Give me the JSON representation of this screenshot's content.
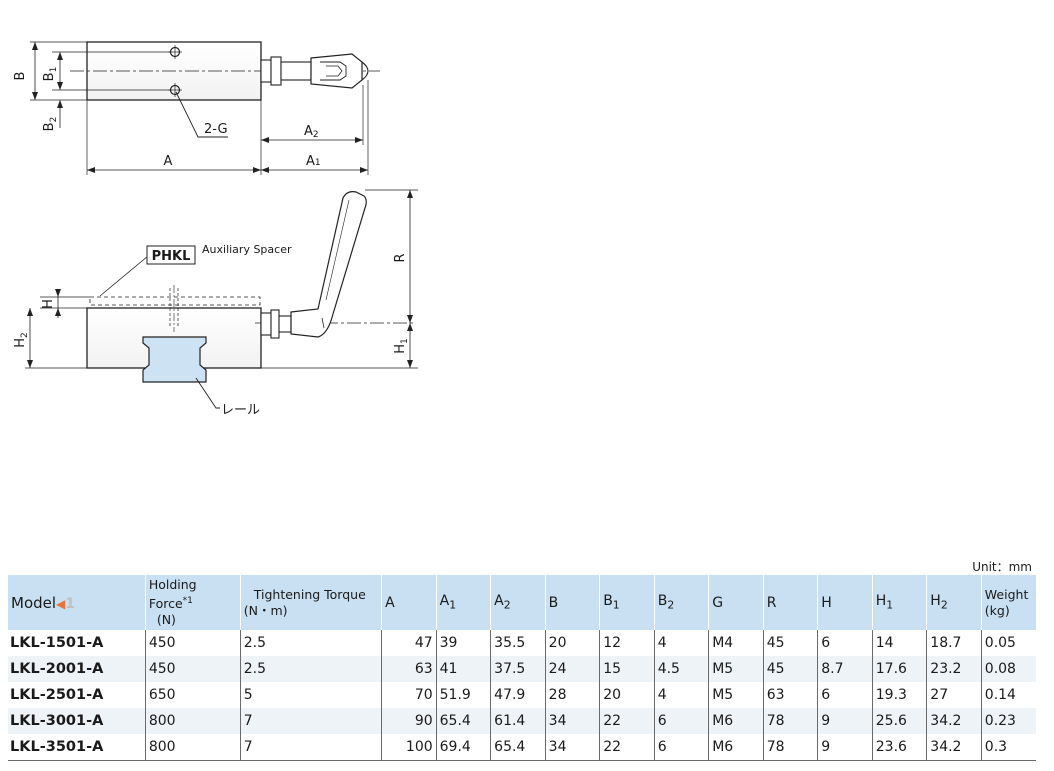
{
  "drawing": {
    "top_view": {
      "label_B": "B",
      "label_B1": "B",
      "label_B1_sub": "1",
      "label_B2": "B",
      "label_B2_sub": "2",
      "label_2G": "2-G",
      "label_A": "A",
      "label_A1": "A",
      "label_A1_sub": "1",
      "label_A2": "A",
      "label_A2_sub": "2"
    },
    "side_view": {
      "phkl": "PHKL",
      "aux_spacer": "Auxiliary Spacer",
      "label_H": "H",
      "label_H2": "H",
      "label_H2_sub": "2",
      "label_R": "R",
      "label_H1": "H",
      "label_H1_sub": "1",
      "rail": "レール"
    }
  },
  "table": {
    "unit": "Unit：mm",
    "headers": {
      "model": "Model",
      "model_flag_num": "1",
      "holding_force": "Holding Force",
      "holding_force_note": "*1",
      "holding_force_unit": "(N)",
      "torque": "Tightening Torque",
      "torque_unit": "(N・m)",
      "A": "A",
      "A1": "A",
      "A1_sub": "1",
      "A2": "A",
      "A2_sub": "2",
      "B": "B",
      "B1": "B",
      "B1_sub": "1",
      "B2": "B",
      "B2_sub": "2",
      "G": "G",
      "R": "R",
      "H": "H",
      "H1": "H",
      "H1_sub": "1",
      "H2": "H",
      "H2_sub": "2",
      "weight": "Weight",
      "weight_unit": "(kg)"
    },
    "rows": [
      {
        "model": "LKL-1501-A",
        "force": "450",
        "torque": "2.5",
        "A": "47",
        "A1": "39",
        "A2": "35.5",
        "B": "20",
        "B1": "12",
        "B2": "4",
        "G": "M4",
        "R": "45",
        "H": "6",
        "H1": "14",
        "H2": "18.7",
        "weight": "0.05"
      },
      {
        "model": "LKL-2001-A",
        "force": "450",
        "torque": "2.5",
        "A": "63",
        "A1": "41",
        "A2": "37.5",
        "B": "24",
        "B1": "15",
        "B2": "4.5",
        "G": "M5",
        "R": "45",
        "H": "8.7",
        "H1": "17.6",
        "H2": "23.2",
        "weight": "0.08"
      },
      {
        "model": "LKL-2501-A",
        "force": "650",
        "torque": "5",
        "A": "70",
        "A1": "51.9",
        "A2": "47.9",
        "B": "28",
        "B1": "20",
        "B2": "4",
        "G": "M5",
        "R": "63",
        "H": "6",
        "H1": "19.3",
        "H2": "27",
        "weight": "0.14"
      },
      {
        "model": "LKL-3001-A",
        "force": "800",
        "torque": "7",
        "A": "90",
        "A1": "65.4",
        "A2": "61.4",
        "B": "34",
        "B1": "22",
        "B2": "6",
        "G": "M6",
        "R": "78",
        "H": "9",
        "H1": "25.6",
        "H2": "34.2",
        "weight": "0.23"
      },
      {
        "model": "LKL-3501-A",
        "force": "800",
        "torque": "7",
        "A": "100",
        "A1": "69.4",
        "A2": "65.4",
        "B": "34",
        "B1": "22",
        "B2": "6",
        "G": "M6",
        "R": "78",
        "H": "9",
        "H1": "23.6",
        "H2": "34.2",
        "weight": "0.3"
      }
    ]
  },
  "colors": {
    "header_bg": "#c9e0f2",
    "stripe_bg": "#eef3f8",
    "rail_fill": "#cde3f4",
    "flag": "#e8743a"
  }
}
